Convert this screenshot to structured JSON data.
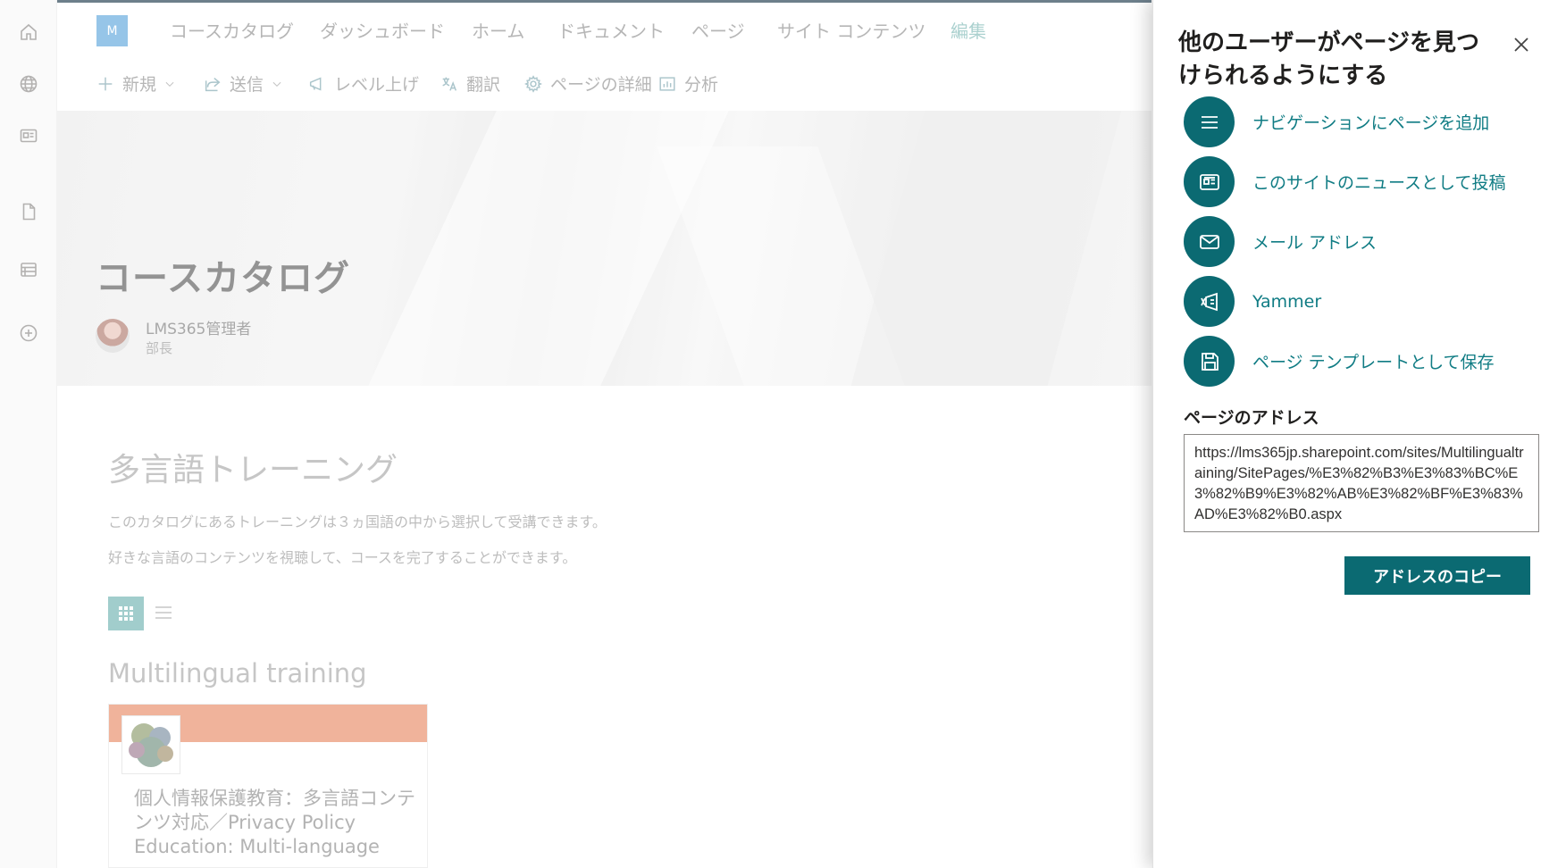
{
  "rail": {
    "icons": [
      "home-icon",
      "globe-icon",
      "news-icon",
      "document-icon",
      "list-icon",
      "add-circle-icon"
    ]
  },
  "site": {
    "logo_letter": "M"
  },
  "topnav": {
    "items": [
      "コースカタログ",
      "ダッシュボード",
      "ホーム",
      "ドキュメント",
      "ページ",
      "サイト コンテンツ"
    ],
    "edit": "編集"
  },
  "commandbar": {
    "new": "新規",
    "send": "送信",
    "promote": "レベル上げ",
    "translate": "翻訳",
    "page_details": "ページの詳細",
    "analytics": "分析"
  },
  "hero": {
    "title": "コースカタログ",
    "author_name": "LMS365管理者",
    "author_role": "部長"
  },
  "content": {
    "section_heading": "多言語トレーニング",
    "paragraph_1": "このカタログにあるトレーニングは３ヵ国語の中から選択して受講できます。",
    "paragraph_2": "好きな言語のコンテンツを視聴して、コースを完了することができます。",
    "subheading": "Multilingual training",
    "card": {
      "title": "個人情報保護教育：多言語コンテンツ対応／Privacy Policy Education: Multi-language",
      "accent_color": "#e88a66"
    }
  },
  "panel": {
    "title": "他のユーザーがページを見つけられるようにする",
    "options": [
      {
        "icon": "menu-icon",
        "label": "ナビゲーションにページを追加"
      },
      {
        "icon": "news-icon",
        "label": "このサイトのニュースとして投稿"
      },
      {
        "icon": "mail-icon",
        "label": "メール アドレス"
      },
      {
        "icon": "yammer-icon",
        "label": "Yammer"
      },
      {
        "icon": "save-icon",
        "label": "ページ テンプレートとして保存"
      }
    ],
    "address_label": "ページのアドレス",
    "address_value": "https://lms365jp.sharepoint.com/sites/Multilingualtraining/SitePages/%E3%82%B3%E3%83%BC%E3%82%B9%E3%82%AB%E3%82%BF%E3%83%AD%E3%82%B0.aspx",
    "copy_button": "アドレスのコピー",
    "accent_color": "#0b6a72"
  }
}
